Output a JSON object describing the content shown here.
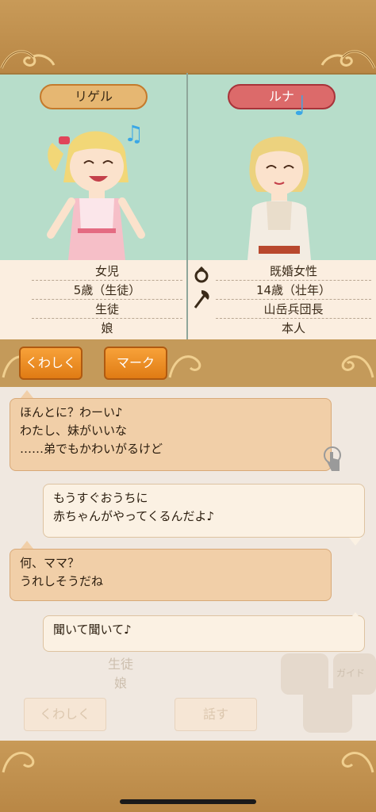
{
  "characters": {
    "left": {
      "name": "リゲル",
      "info": [
        "女児",
        "5歳（生徒）",
        "生徒",
        "娘"
      ]
    },
    "right": {
      "name": "ルナ",
      "info": [
        "既婚女性",
        "14歳（壮年）",
        "山岳兵団長",
        "本人"
      ]
    }
  },
  "buttons": {
    "details": "くわしく",
    "mark": "マーク"
  },
  "chat": [
    {
      "side": "left",
      "text": "ほんとに？わーい♪\nわたし、妹がいいな\n……弟でもかわいがるけど"
    },
    {
      "side": "right",
      "text": "もうすぐおうちに\n赤ちゃんがやってくるんだよ♪"
    },
    {
      "side": "left",
      "text": "何、ママ？\nうれしそうだね"
    },
    {
      "side": "right",
      "text": "聞いて聞いて♪"
    }
  ],
  "background_ghost": {
    "role": "生徒",
    "relation": "娘",
    "details_button": "くわしく",
    "talk_button": "話す",
    "guide_label": "ガイド"
  },
  "icons": {
    "music_note": "music-note-icon",
    "ring": "ring-icon",
    "axe": "axe-icon",
    "touch": "touch-hand-icon"
  },
  "colors": {
    "frame": "#c49a5a",
    "portrait_bg": "#b7ddca",
    "info_bg": "#fbeee0",
    "orange_button": "#f29227",
    "left_name_pill": "#e6b772",
    "right_name_pill": "#dc6a6a",
    "note": "#3aa7e6"
  }
}
